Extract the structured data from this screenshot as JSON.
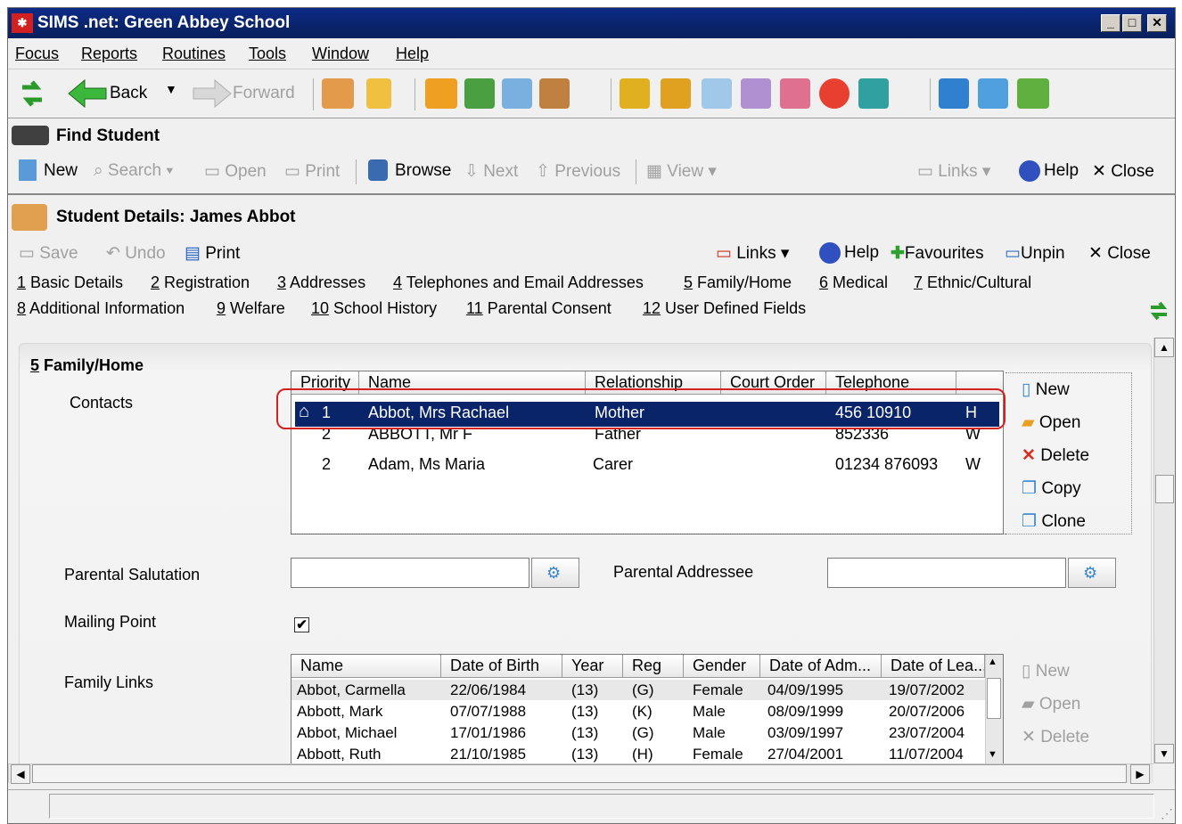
{
  "window": {
    "title": "SIMS .net: Green Abbey School"
  },
  "menu": [
    "Focus",
    "Reports",
    "Routines",
    "Tools",
    "Window",
    "Help"
  ],
  "main_toolbar": {
    "back": "Back",
    "forward": "Forward"
  },
  "find_student": {
    "title": "Find Student",
    "new": "New",
    "search": "Search",
    "open": "Open",
    "print": "Print",
    "browse": "Browse",
    "next": "Next",
    "previous": "Previous",
    "view": "View",
    "links": "Links",
    "help": "Help",
    "close": "Close"
  },
  "student_details": {
    "title": "Student Details: James Abbot",
    "save": "Save",
    "undo": "Undo",
    "print": "Print",
    "links": "Links",
    "help": "Help",
    "favourites": "Favourites",
    "unpin": "Unpin",
    "close": "Close"
  },
  "tabs": [
    {
      "num": "1",
      "label": " Basic Details"
    },
    {
      "num": "2",
      "label": " Registration"
    },
    {
      "num": "3",
      "label": " Addresses"
    },
    {
      "num": "4",
      "label": " Telephones and Email Addresses"
    },
    {
      "num": "5",
      "label": " Family/Home"
    },
    {
      "num": "6",
      "label": " Medical"
    },
    {
      "num": "7",
      "label": " Ethnic/Cultural"
    },
    {
      "num": "8",
      "label": " Additional Information"
    },
    {
      "num": "9",
      "label": " Welfare"
    },
    {
      "num": "10",
      "label": " School History"
    },
    {
      "num": "11",
      "label": " Parental Consent"
    },
    {
      "num": "12",
      "label": " User Defined Fields"
    }
  ],
  "section": {
    "num": "5",
    "title": " Family/Home"
  },
  "contacts": {
    "label": "Contacts",
    "columns": [
      "Priority",
      "Name",
      "Relationship",
      "Court Order",
      "Telephone",
      ""
    ],
    "rows": [
      {
        "priority": "1",
        "name": "Abbot, Mrs Rachael",
        "relationship": "Mother",
        "court_order": "",
        "telephone": "456 10910",
        "type": "H"
      },
      {
        "priority": "2",
        "name": "ABBOTT, Mr F",
        "relationship": "Father",
        "court_order": "",
        "telephone": "852336",
        "type": "W"
      },
      {
        "priority": "2",
        "name": "Adam, Ms Maria",
        "relationship": "Carer",
        "court_order": "",
        "telephone": "01234 876093",
        "type": "W"
      }
    ],
    "actions": {
      "new": "New",
      "open": "Open",
      "delete": "Delete",
      "copy": "Copy",
      "clone": "Clone"
    }
  },
  "parental_salutation": {
    "label": "Parental Salutation",
    "value": ""
  },
  "parental_addressee": {
    "label": "Parental Addressee",
    "value": ""
  },
  "mailing_point": {
    "label": "Mailing Point",
    "checked": "✔"
  },
  "family_links": {
    "label": "Family Links",
    "columns": [
      "Name",
      "Date of Birth",
      "Year",
      "Reg",
      "Gender",
      "Date of Adm...",
      "Date of Lea..."
    ],
    "rows": [
      {
        "name": "Abbot, Carmella",
        "dob": "22/06/1984",
        "year": "(13)",
        "reg": "(G)",
        "gender": "Female",
        "adm": "04/09/1995",
        "lea": "19/07/2002"
      },
      {
        "name": "Abbott, Mark",
        "dob": "07/07/1988",
        "year": "(13)",
        "reg": "(K)",
        "gender": "Male",
        "adm": "08/09/1999",
        "lea": "20/07/2006"
      },
      {
        "name": "Abbot, Michael",
        "dob": "17/01/1986",
        "year": "(13)",
        "reg": "(G)",
        "gender": "Male",
        "adm": "03/09/1997",
        "lea": "23/07/2004"
      },
      {
        "name": "Abbott, Ruth",
        "dob": "21/10/1985",
        "year": "(13)",
        "reg": "(H)",
        "gender": "Female",
        "adm": "27/04/2001",
        "lea": "11/07/2004"
      }
    ],
    "actions": {
      "new": "New",
      "open": "Open",
      "delete": "Delete"
    }
  },
  "colors": {
    "title_bar": "#0a246a",
    "selection": "#0a246a",
    "highlight_ring": "#d32020"
  }
}
